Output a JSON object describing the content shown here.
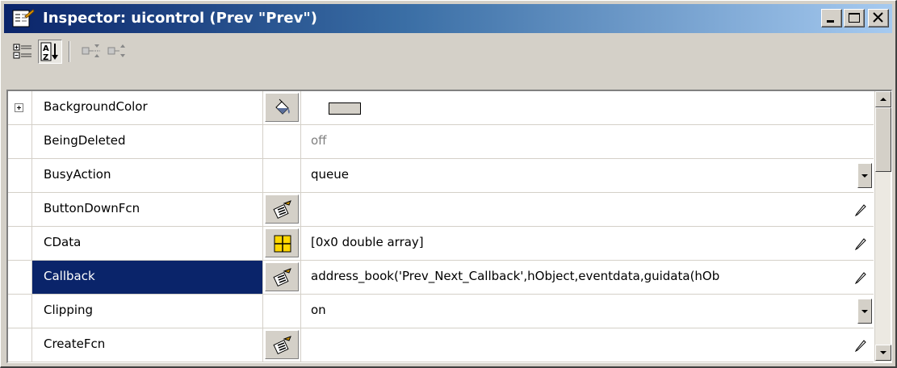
{
  "window": {
    "title": "Inspector: uicontrol (Prev \"Prev\")",
    "icon": "inspector-app-icon",
    "controls": [
      "minimize-icon",
      "maximize-icon",
      "close-icon"
    ]
  },
  "toolbar": {
    "buttons": [
      {
        "name": "categorized-view",
        "icon": "category-view-icon",
        "pressed": false
      },
      {
        "name": "sort-alphabetical",
        "icon": "sort-az-icon",
        "pressed": true
      },
      {
        "name": "expand-all",
        "icon": "expand-all-icon",
        "pressed": false
      },
      {
        "name": "collapse-all",
        "icon": "collapse-all-icon",
        "pressed": false
      }
    ]
  },
  "properties": [
    {
      "name": "BackgroundColor",
      "editor": "paint-bucket-icon",
      "value": "",
      "swatch": "#d4d0c8",
      "expandable": true
    },
    {
      "name": "BeingDeleted",
      "editor": "",
      "value": "off",
      "disabled": true
    },
    {
      "name": "BusyAction",
      "editor": "",
      "value": "queue",
      "dropdown": true
    },
    {
      "name": "ButtonDownFcn",
      "editor": "callback-edit-icon",
      "value": "",
      "pencil": true
    },
    {
      "name": "CData",
      "editor": "array-grid-icon",
      "value": "[0x0  double array]",
      "pencil": true
    },
    {
      "name": "Callback",
      "editor": "callback-edit-icon",
      "value": "address_book('Prev_Next_Callback',hObject,eventdata,guidata(hOb",
      "pencil": true,
      "selected": true
    },
    {
      "name": "Clipping",
      "editor": "",
      "value": "on",
      "dropdown": true
    },
    {
      "name": "CreateFcn",
      "editor": "callback-edit-icon",
      "value": "",
      "pencil": true,
      "dropdown": true
    }
  ],
  "colors": {
    "title_start": "#0a246a",
    "title_end": "#a6caf0",
    "selection": "#0a246a",
    "face": "#d4d0c8"
  }
}
